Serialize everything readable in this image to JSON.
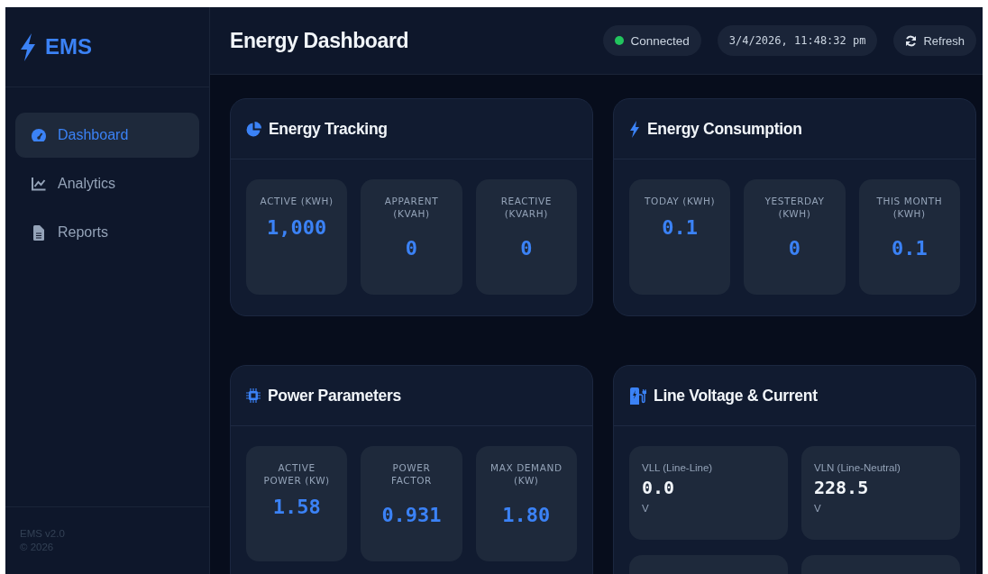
{
  "sidebar": {
    "logo": "EMS",
    "items": [
      {
        "label": "Dashboard",
        "selected": true
      },
      {
        "label": "Analytics",
        "selected": false
      },
      {
        "label": "Reports",
        "selected": false
      }
    ],
    "footer": [
      "EMS v2.0",
      "© 2026"
    ]
  },
  "header": {
    "title": "Energy Dashboard",
    "status": {
      "label": "Connected",
      "connected": true
    },
    "datetime": "3/4/2026, 11:48:32 pm",
    "refresh": "Refresh"
  },
  "cards": [
    {
      "title": "Energy Tracking",
      "kind": "stats",
      "tiles": [
        {
          "label": "ACTIVE (KWH)",
          "value": "1,000"
        },
        {
          "label": "APPARENT (KVAH)",
          "value": "0"
        },
        {
          "label": "REACTIVE (KVARH)",
          "value": "0"
        }
      ]
    },
    {
      "title": "Energy Consumption",
      "kind": "stats",
      "tiles": [
        {
          "label": "TODAY (KWH)",
          "value": "0.1"
        },
        {
          "label": "YESTERDAY (KWH)",
          "value": "0"
        },
        {
          "label": "THIS MONTH (KWH)",
          "value": "0.1"
        }
      ]
    },
    {
      "title": "Power Parameters",
      "kind": "stats",
      "tiles": [
        {
          "label": "ACTIVE POWER (KW)",
          "value": "1.58"
        },
        {
          "label": "POWER FACTOR",
          "value": "0.931"
        },
        {
          "label": "MAX DEMAND (KW)",
          "value": "1.80"
        }
      ]
    },
    {
      "title": "Line Voltage & Current",
      "kind": "readings",
      "tiles": [
        {
          "label": "VLL (Line-Line)",
          "value": "0.0",
          "unit": "V"
        },
        {
          "label": "VLN (Line-Neutral)",
          "value": "228.5",
          "unit": "V"
        }
      ]
    }
  ]
}
